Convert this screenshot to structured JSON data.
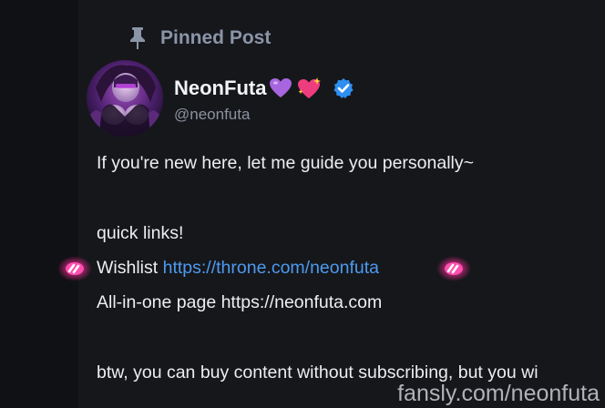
{
  "pinned": {
    "label": "Pinned Post",
    "icon": "pin-icon"
  },
  "author": {
    "display_name": "NeonFuta",
    "handle": "@neonfuta",
    "name_emojis": [
      "purple-heart-icon",
      "sparkling-heart-icon"
    ],
    "verified": true
  },
  "post": {
    "line1": "If you're new here, let me guide you personally~",
    "line2": "quick links!",
    "wishlist_label": "Wishlist ",
    "wishlist_link": "https://throne.com/neonfuta",
    "line4": "All-in-one page https://neonfuta.com",
    "line5": "btw, you can buy content without subscribing, but you wi"
  },
  "watermark": "fansly.com/neonfuta",
  "colors": {
    "background": "#16171b",
    "link": "#4d9af0",
    "verified": "#2f8ff1",
    "neon_pink": "#ff2a9a"
  }
}
